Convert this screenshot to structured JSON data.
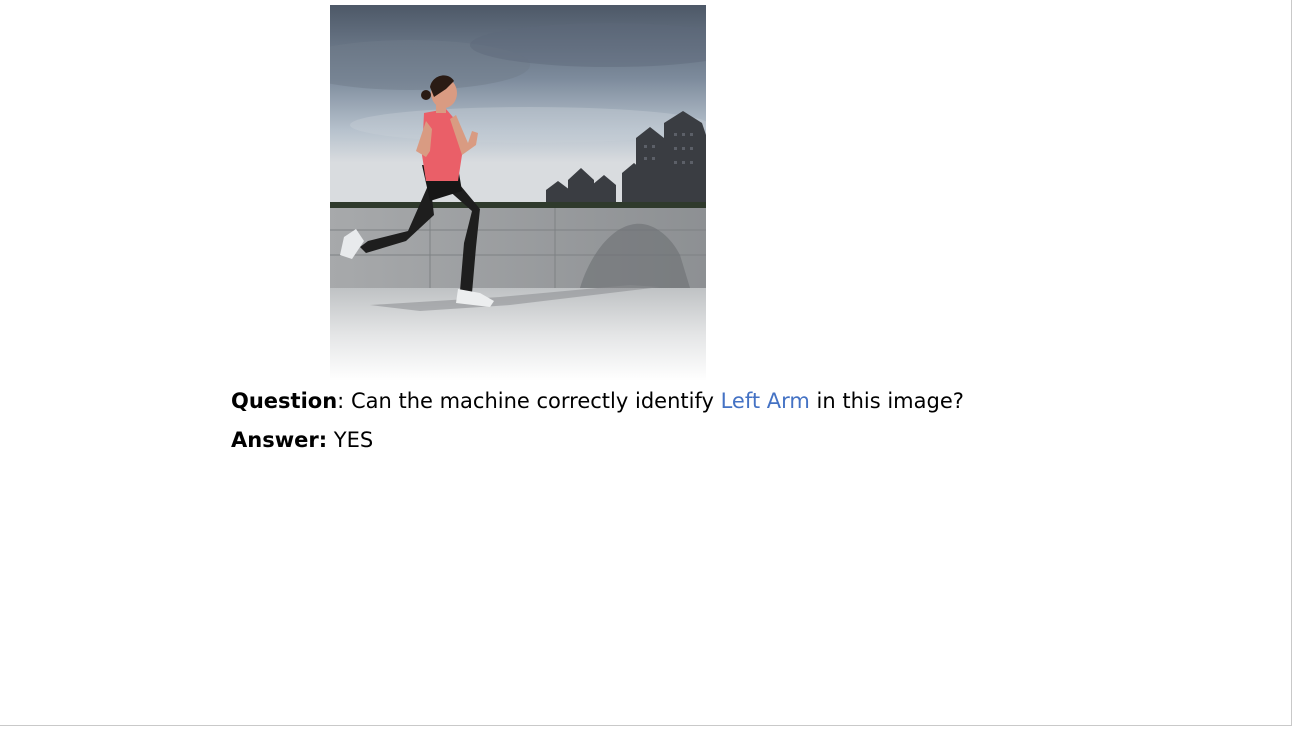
{
  "question": {
    "label": "Question",
    "separator": ": ",
    "text_before": "Can the machine correctly identify ",
    "highlight": "Left Arm",
    "text_after": " in this image?"
  },
  "answer": {
    "label": "Answer:",
    "value": " YES"
  },
  "colors": {
    "highlight": "#4472c4",
    "text": "#000000",
    "background": "#ffffff"
  }
}
